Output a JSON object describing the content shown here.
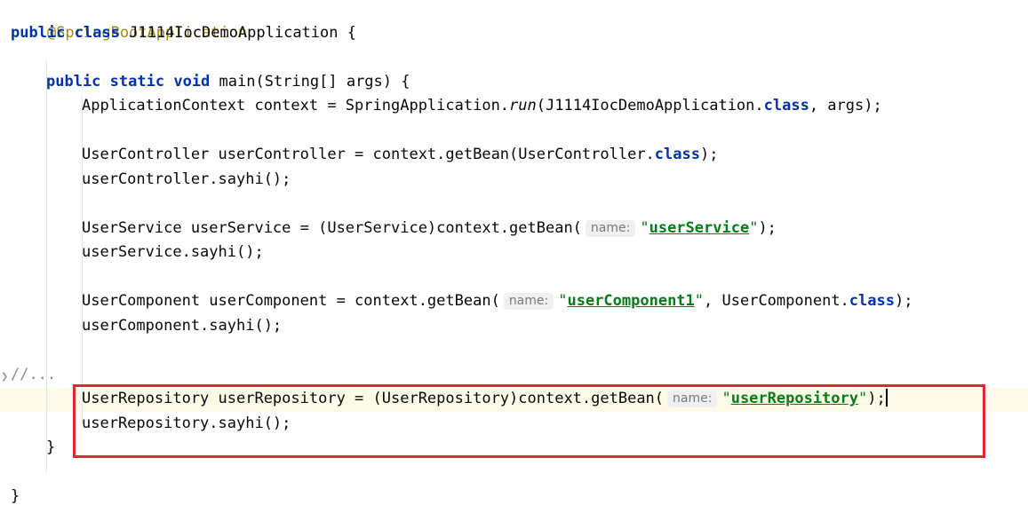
{
  "editor": {
    "lines": [
      {
        "t": "@SpringBootApplication"
      },
      {
        "kw1": "public",
        "kw2": "class",
        "rest": "J1114IocDemoApplication {"
      },
      {
        "kw1": "public",
        "kw2": "static",
        "kw3": "void",
        "rest": "main(String[] args) {"
      },
      {
        "pre": "ApplicationContext context = SpringApplication.",
        "call": "run",
        "mid": "(J1114IocDemoApplication.",
        "kw": "class",
        "post": ", args);"
      },
      {
        "pre": "UserController userController = context.getBean(UserController.",
        "kw": "class",
        "post": ");"
      },
      {
        "t": "userController.sayhi();"
      },
      {
        "pre": "UserService userService = (UserService)context.getBean(",
        "hint": "name:",
        "q1": "\"",
        "str": "userService",
        "q2": "\"",
        "post": ");"
      },
      {
        "t": "userService.sayhi();"
      },
      {
        "pre": "UserComponent userComponent = context.getBean(",
        "hint": "name:",
        "q1": "\"",
        "str": "userComponent1",
        "q2": "\"",
        "mid": ", UserComponent.",
        "kw": "class",
        "post": ");"
      },
      {
        "t": "userComponent.sayhi();"
      },
      {
        "t": "//..."
      },
      {
        "pre": "UserRepository userRepository = (UserRepository)context.getBean(",
        "hint": "name:",
        "q1": "\"",
        "str": "userRepository",
        "q2": "\"",
        "post": ");"
      },
      {
        "t": "userRepository.sayhi();"
      },
      {
        "t": "}"
      },
      {
        "t": "}"
      }
    ]
  },
  "colors": {
    "annotation": "#9e880d",
    "keyword": "#0033b3",
    "string": "#067d17",
    "fold_comment": "#8c8c8c",
    "highlight_box": "#e0262e",
    "current_line": "#fdfbe8"
  },
  "icons": {
    "fold_marker": "fold-expand-icon"
  }
}
